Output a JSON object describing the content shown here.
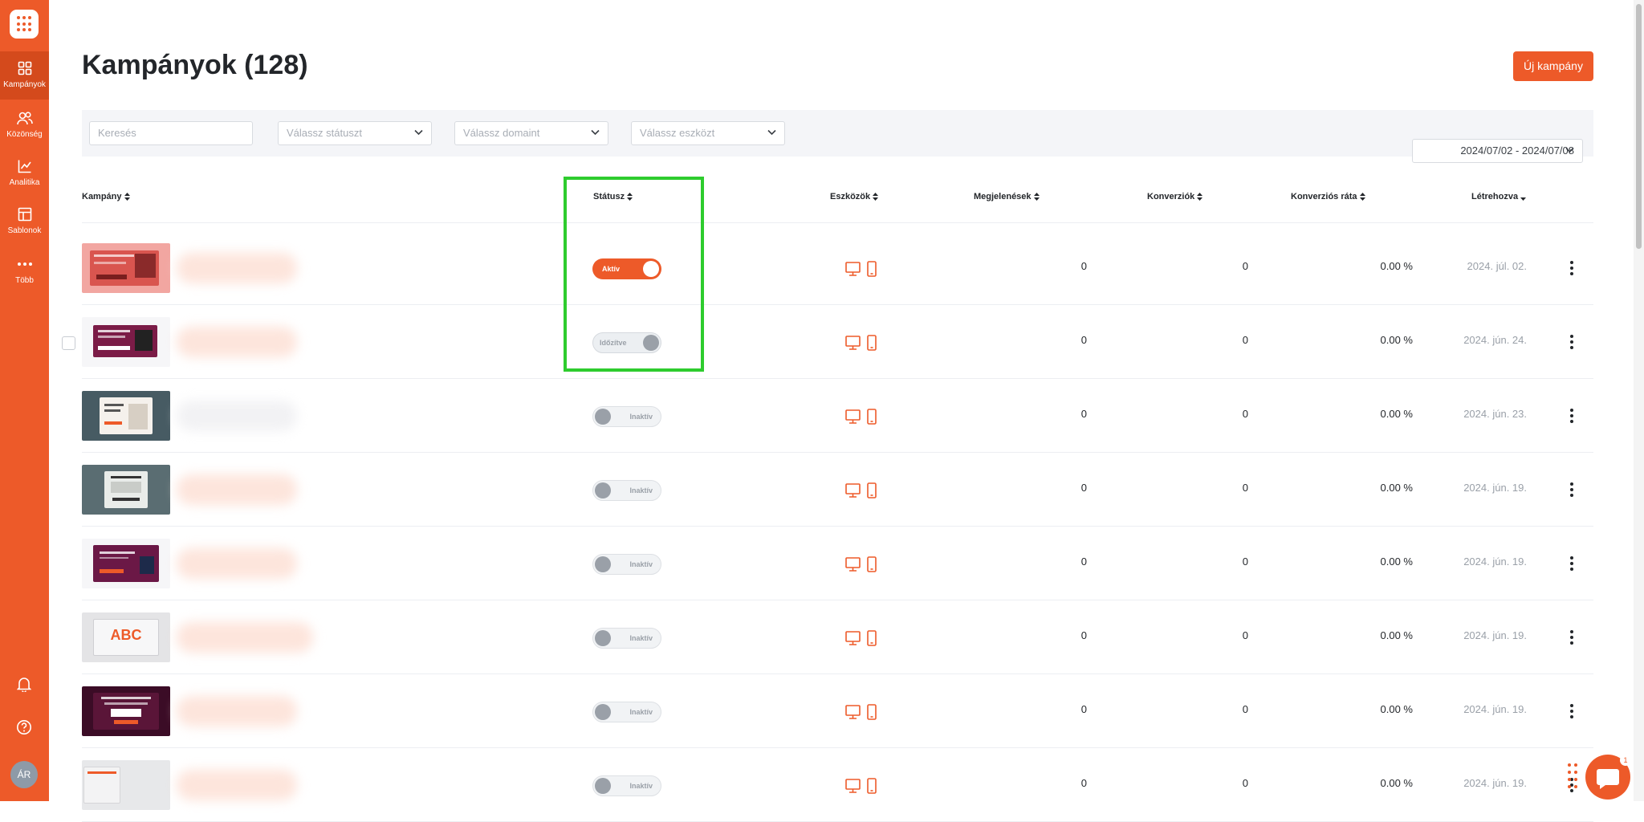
{
  "sidebar": {
    "items": [
      {
        "label": "Kampányok",
        "icon": "grid-icon",
        "active": true
      },
      {
        "label": "Közönség",
        "icon": "users-icon",
        "active": false
      },
      {
        "label": "Analitika",
        "icon": "chart-icon",
        "active": false
      },
      {
        "label": "Sablonok",
        "icon": "template-icon",
        "active": false
      },
      {
        "label": "Több",
        "icon": "more-icon",
        "active": false
      }
    ],
    "avatar_initials": "ÁR"
  },
  "header": {
    "title": "Kampányok (128)",
    "new_button": "Új kampány"
  },
  "filters": {
    "search_placeholder": "Keresés",
    "status_placeholder": "Válassz státuszt",
    "domain_placeholder": "Válassz domaint",
    "device_placeholder": "Válassz eszközt",
    "date_range": "2024/07/02 - 2024/07/08"
  },
  "table": {
    "columns": {
      "campaign": "Kampány",
      "status": "Státusz",
      "devices": "Eszközök",
      "impressions": "Megjelenések",
      "conversions": "Konverziók",
      "conversion_rate": "Konverziós ráta",
      "created": "Létrehozva"
    },
    "rows": [
      {
        "status": "Aktív",
        "state": "on",
        "impressions": "0",
        "conversions": "0",
        "rate": "0.00 %",
        "created": "2024. júl. 02."
      },
      {
        "status": "Időzítve",
        "state": "sched",
        "impressions": "0",
        "conversions": "0",
        "rate": "0.00 %",
        "created": "2024. jún. 24."
      },
      {
        "status": "Inaktív",
        "state": "off",
        "impressions": "0",
        "conversions": "0",
        "rate": "0.00 %",
        "created": "2024. jún. 23."
      },
      {
        "status": "Inaktív",
        "state": "off",
        "impressions": "0",
        "conversions": "0",
        "rate": "0.00 %",
        "created": "2024. jún. 19."
      },
      {
        "status": "Inaktív",
        "state": "off",
        "impressions": "0",
        "conversions": "0",
        "rate": "0.00 %",
        "created": "2024. jún. 19."
      },
      {
        "status": "Inaktív",
        "state": "off",
        "impressions": "0",
        "conversions": "0",
        "rate": "0.00 %",
        "created": "2024. jún. 19."
      },
      {
        "status": "Inaktív",
        "state": "off",
        "impressions": "0",
        "conversions": "0",
        "rate": "0.00 %",
        "created": "2024. jún. 19."
      },
      {
        "status": "Inaktív",
        "state": "off",
        "impressions": "0",
        "conversions": "0",
        "rate": "0.00 %",
        "created": "2024. jún. 19."
      }
    ],
    "thumb_text_abc": "ABC"
  },
  "chat": {
    "badge": "1"
  },
  "colors": {
    "accent": "#ed5a29",
    "highlight": "#2ecc2e"
  }
}
